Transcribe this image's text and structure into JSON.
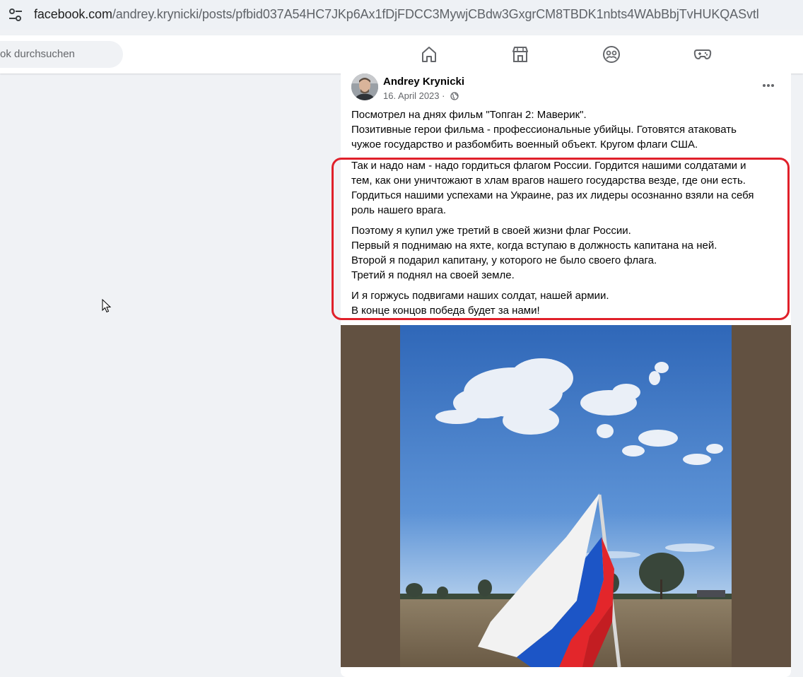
{
  "browser": {
    "url_host": "facebook.com",
    "url_path": "/andrey.krynicki/posts/pfbid037A54HC7JKp6Ax1fDjFDCC3MywjCBdw3GxgrCM8TBDK1nbts4WAbBbjTvHUKQASvtl"
  },
  "topbar": {
    "search_placeholder": "ok durchsuchen",
    "nav_icons": [
      "home-icon",
      "marketplace-icon",
      "groups-icon",
      "gaming-icon"
    ]
  },
  "post": {
    "author": "Andrey Krynicki",
    "date": "16. April 2023 ·",
    "privacy_icon": "globe-icon",
    "paragraph1": [
      "Посмотрел на днях фильм \"Топган 2: Маверик\".",
      "Позитивные герои фильма - профессиональные убийцы. Готовятся атаковать",
      "чужое государство и разбомбить военный объект. Кругом флаги США."
    ],
    "paragraph2": [
      "Так и надо нам - надо гордиться флагом России. Гордится нашими солдатами и",
      "тем, как они уничтожают в хлам врагов нашего государства везде, где они есть.",
      "Гордиться нашими успехами на Украине, раз их лидеры осознанно взяли на себя",
      "роль нашего врага."
    ],
    "paragraph3": [
      "Поэтому я купил уже третий в своей жизни флаг России.",
      "Первый я поднимаю на яхте, когда вступаю в должность капитана на ней.",
      "Второй я подарил капитану, у которого не было своего флага.",
      "Третий я поднял на своей земле."
    ],
    "paragraph4": [
      "И я горжусь подвигами наших солдат, нашей армии.",
      "В конце концов победа будет за нами!"
    ],
    "highlight_color": "#e0202a"
  }
}
